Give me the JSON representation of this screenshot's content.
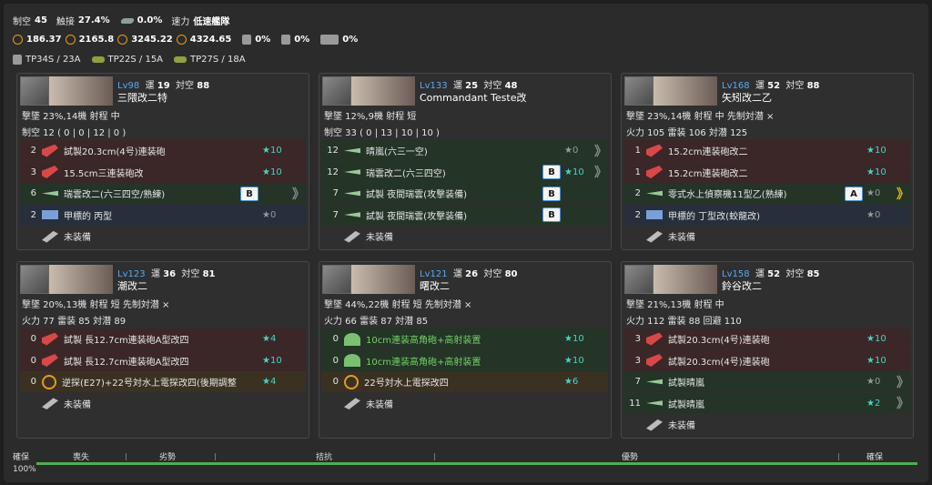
{
  "summary": {
    "line1": [
      {
        "label": "制空",
        "value": "45"
      },
      {
        "label": "触接",
        "value": "27.4%"
      },
      {
        "label": "",
        "value": "0.0%"
      },
      {
        "label": "速力",
        "value": "低速艦隊"
      }
    ],
    "line2": [
      "186.37",
      "2165.8",
      "3245.22",
      "4324.65",
      "0%",
      "0%",
      "0%"
    ],
    "line3": [
      "TP34S / 23A",
      "TP22S / 15A",
      "TP27S / 18A"
    ]
  },
  "ships": [
    {
      "lv": "Lv98",
      "luck_label": "運",
      "luck": "19",
      "asw_label": "対空",
      "asw": "88",
      "name": "三隈改二特",
      "stats1": "撃墜 23%,14機  射程 中",
      "stats2": "制空 12 ( 0 | 0 | 12 | 0 )",
      "slots": [
        {
          "type": "gun",
          "count": "2",
          "name": "試製20.3cm(4号)連装砲",
          "prof": "",
          "star": "★10",
          "star_color": "c",
          "chev": ""
        },
        {
          "type": "gun",
          "count": "3",
          "name": "15.5cm三連装砲改",
          "prof": "",
          "star": "★10",
          "star_color": "c",
          "chev": ""
        },
        {
          "type": "air",
          "count": "6",
          "name": "瑞雲改二(六三四空/熟練)",
          "prof": "B",
          "star": "",
          "star_color": "c",
          "chev": "》"
        },
        {
          "type": "rad",
          "count": "2",
          "name": "甲標的 丙型",
          "prof": "",
          "star": "★0",
          "star_color": "g",
          "chev": ""
        },
        {
          "type": "emp",
          "count": "",
          "name": "未装備",
          "prof": "",
          "star": "",
          "star_color": "g",
          "chev": ""
        }
      ]
    },
    {
      "lv": "Lv133",
      "luck_label": "運",
      "luck": "25",
      "asw_label": "対空",
      "asw": "48",
      "name": "Commandant Teste改",
      "stats1": "撃墜 12%,9機  射程 短",
      "stats2": "制空 33 ( 0 | 13 | 10 | 10 )",
      "slots": [
        {
          "type": "air",
          "count": "12",
          "name": "晴嵐(六三一空)",
          "prof": "",
          "star": "★0",
          "star_color": "g",
          "chev": "》"
        },
        {
          "type": "air",
          "count": "12",
          "name": "瑞雲改二(六三四空)",
          "prof": "B",
          "star": "★10",
          "star_color": "c",
          "chev": "》"
        },
        {
          "type": "air",
          "count": "7",
          "name": "試製 夜間瑞雲(攻撃装備)",
          "prof": "B",
          "star": "",
          "star_color": "c",
          "chev": ""
        },
        {
          "type": "air",
          "count": "7",
          "name": "試製 夜間瑞雲(攻撃装備)",
          "prof": "B",
          "star": "",
          "star_color": "c",
          "chev": ""
        },
        {
          "type": "emp",
          "count": "",
          "name": "未装備",
          "prof": "",
          "star": "",
          "star_color": "g",
          "chev": ""
        }
      ]
    },
    {
      "lv": "Lv168",
      "luck_label": "運",
      "luck": "52",
      "asw_label": "対空",
      "asw": "88",
      "name": "矢矧改二乙",
      "stats1": "撃墜 23%,14機  射程 中  先制対潜 ×",
      "stats2": "火力 105  雷装 106  対潜 125",
      "slots": [
        {
          "type": "gun",
          "count": "1",
          "name": "15.2cm連装砲改二",
          "prof": "",
          "star": "★10",
          "star_color": "c",
          "chev": ""
        },
        {
          "type": "gun",
          "count": "1",
          "name": "15.2cm連装砲改二",
          "prof": "",
          "star": "★10",
          "star_color": "c",
          "chev": ""
        },
        {
          "type": "air",
          "count": "2",
          "name": "零式水上偵察機11型乙(熟練)",
          "prof": "A",
          "star": "★0",
          "star_color": "g",
          "chev": "》",
          "chev_gold": true
        },
        {
          "type": "rad",
          "count": "2",
          "name": "甲標的 丁型改(蛟龍改)",
          "prof": "",
          "star": "★0",
          "star_color": "g",
          "chev": ""
        },
        {
          "type": "emp",
          "count": "",
          "name": "未装備",
          "prof": "",
          "star": "",
          "star_color": "g",
          "chev": ""
        }
      ]
    },
    {
      "lv": "Lv123",
      "luck_label": "運",
      "luck": "36",
      "asw_label": "対空",
      "asw": "81",
      "name": "潮改二",
      "stats1": "撃墜 20%,13機  射程 短  先制対潜 ×",
      "stats2": "火力 77  雷装 85  対潜 89",
      "slots": [
        {
          "type": "gun",
          "count": "0",
          "name": "試製 長12.7cm連装砲A型改四",
          "prof": "",
          "star": "★4",
          "star_color": "c",
          "chev": ""
        },
        {
          "type": "gun",
          "count": "0",
          "name": "試製 長12.7cm連装砲A型改四",
          "prof": "",
          "star": "★10",
          "star_color": "c",
          "chev": ""
        },
        {
          "type": "oth",
          "count": "0",
          "name": "逆探(E27)+22号対水上電探改四(後期調整",
          "prof": "",
          "star": "★4",
          "star_color": "c",
          "chev": ""
        },
        {
          "type": "emp",
          "count": "",
          "name": "未装備",
          "prof": "",
          "star": "",
          "star_color": "g",
          "chev": ""
        }
      ]
    },
    {
      "lv": "Lv121",
      "luck_label": "運",
      "luck": "26",
      "asw_label": "対空",
      "asw": "80",
      "name": "曙改二",
      "stats1": "撃墜 44%,22機  射程 短  先制対潜 ×",
      "stats2": "火力 66  雷装 87  対潜 85",
      "slots": [
        {
          "type": "aa",
          "count": "0",
          "name": "10cm連装高角砲+高射装置",
          "prof": "",
          "star": "★10",
          "star_color": "c",
          "chev": "",
          "green": true
        },
        {
          "type": "aa",
          "count": "0",
          "name": "10cm連装高角砲+高射装置",
          "prof": "",
          "star": "★10",
          "star_color": "c",
          "chev": "",
          "green": true
        },
        {
          "type": "oth",
          "count": "0",
          "name": "22号対水上電探改四",
          "prof": "",
          "star": "★6",
          "star_color": "c",
          "chev": ""
        },
        {
          "type": "emp",
          "count": "",
          "name": "未装備",
          "prof": "",
          "star": "",
          "star_color": "g",
          "chev": ""
        }
      ]
    },
    {
      "lv": "Lv158",
      "luck_label": "運",
      "luck": "52",
      "asw_label": "対空",
      "asw": "85",
      "name": "鈴谷改二",
      "stats1": "撃墜 21%,13機  射程 中",
      "stats2": "火力 112  雷装 88  回避 110",
      "slots": [
        {
          "type": "gun",
          "count": "3",
          "name": "試製20.3cm(4号)連装砲",
          "prof": "",
          "star": "★10",
          "star_color": "c",
          "chev": ""
        },
        {
          "type": "gun",
          "count": "3",
          "name": "試製20.3cm(4号)連装砲",
          "prof": "",
          "star": "★10",
          "star_color": "c",
          "chev": ""
        },
        {
          "type": "air",
          "count": "7",
          "name": "試製晴嵐",
          "prof": "",
          "star": "★0",
          "star_color": "g",
          "chev": "》"
        },
        {
          "type": "air",
          "count": "11",
          "name": "試製晴嵐",
          "prof": "",
          "star": "★2",
          "star_color": "c",
          "chev": "》"
        },
        {
          "type": "emp",
          "count": "",
          "name": "未装備",
          "prof": "",
          "star": "",
          "star_color": "g",
          "chev": ""
        }
      ]
    }
  ],
  "air_state": {
    "left_label": "確保",
    "left_value": "100%",
    "segments": [
      "喪失",
      "劣勢",
      "拮抗",
      "優勢",
      "確保"
    ]
  }
}
